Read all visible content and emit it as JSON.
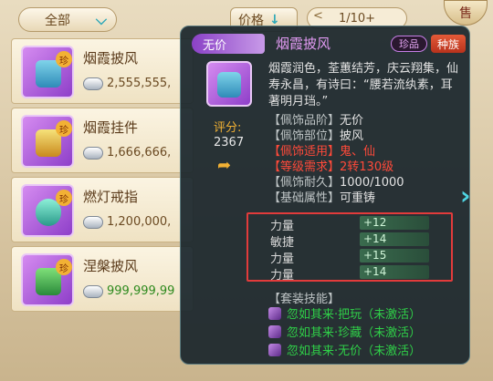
{
  "toolbar": {
    "filter_label": "全部",
    "sort_label": "价格",
    "page_label": "1/10+",
    "sell_label": "售"
  },
  "items": [
    {
      "name": "烟霞披风",
      "badge": "珍",
      "price": "2,555,555,",
      "price_green": false
    },
    {
      "name": "烟霞挂件",
      "badge": "珍",
      "price": "1,666,666,",
      "price_green": false
    },
    {
      "name": "燃灯戒指",
      "badge": "珍",
      "price": "1,200,000,",
      "price_green": false
    },
    {
      "name": "涅槃披风",
      "badge": "珍",
      "price": "999,999,99",
      "price_green": true
    }
  ],
  "tooltip": {
    "rank_label": "无价",
    "title": "烟霞披风",
    "badge_rare": "珍品",
    "badge_race": "种族",
    "score_label": "评分:",
    "score_value": "2367",
    "description": "烟霞润色，荃蕙结芳，庆云翔集，仙寿永昌，有诗曰：“腰若流纨素，耳著明月珰。”",
    "properties": [
      {
        "key": "【佩饰品阶】",
        "value": "无价",
        "highlight": false
      },
      {
        "key": "【佩饰部位】",
        "value": "披风",
        "highlight": false
      },
      {
        "key": "【佩饰适用】",
        "value": "鬼、仙",
        "highlight": true
      },
      {
        "key": "【等级需求】",
        "value": "2转130级",
        "highlight": true
      },
      {
        "key": "【佩饰耐久】",
        "value": "1000/1000",
        "highlight": false
      },
      {
        "key": "【基础属性】",
        "value": "可重铸",
        "highlight": false
      }
    ],
    "stats": [
      {
        "name": "力量",
        "value": "+12"
      },
      {
        "name": "敏捷",
        "value": "+14"
      },
      {
        "name": "力量",
        "value": "+15"
      },
      {
        "name": "力量",
        "value": "+14"
      }
    ],
    "skill_header": "【套装技能】",
    "skills": [
      "忽如其来·把玩（未激活）",
      "忽如其来·珍藏（未激活）",
      "忽如其来·无价（未激活）"
    ]
  },
  "colors": {
    "accent_teal": "#2aa7b8",
    "rare_purple": "#e29af3",
    "requirement_red": "#ff4a3a",
    "skill_green": "#2fcf48",
    "highlight_box": "#e23b3b"
  }
}
